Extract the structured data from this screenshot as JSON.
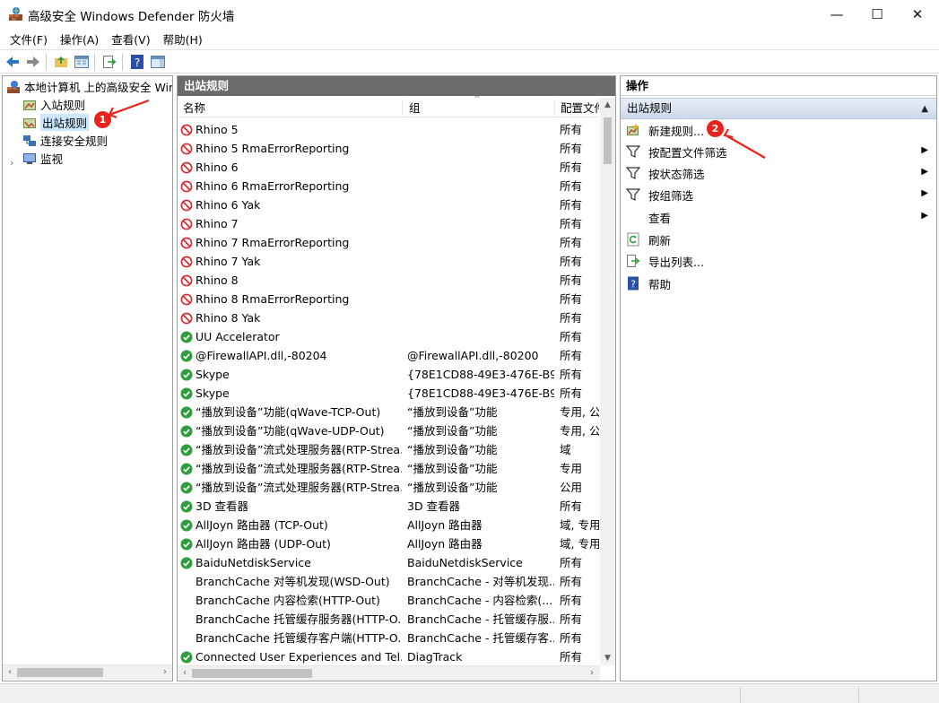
{
  "window": {
    "title": "高级安全 Windows Defender 防火墙",
    "controls": {
      "minimize": "—",
      "maximize": "☐",
      "close": "✕"
    }
  },
  "menu": [
    "文件(F)",
    "操作(A)",
    "查看(V)",
    "帮助(H)"
  ],
  "toolbar": {
    "icons": [
      "back-arrow-icon",
      "forward-arrow-icon",
      "up-folder-icon",
      "show-tree-icon",
      "export-icon",
      "help-icon",
      "action-pane-icon"
    ]
  },
  "tree": {
    "root": "本地计算机 上的高级安全 Windows Defender 防火墙",
    "items": [
      "入站规则",
      "出站规则",
      "连接安全规则",
      "监视"
    ],
    "selected": "出站规则"
  },
  "center": {
    "title": "出站规则",
    "columns": [
      "名称",
      "组",
      "配置文件"
    ],
    "rows": [
      {
        "name": "Rhino 5",
        "group": "",
        "profile": "所有",
        "status": "blocked"
      },
      {
        "name": "Rhino 5 RmaErrorReporting",
        "group": "",
        "profile": "所有",
        "status": "blocked"
      },
      {
        "name": "Rhino 6",
        "group": "",
        "profile": "所有",
        "status": "blocked"
      },
      {
        "name": "Rhino 6 RmaErrorReporting",
        "group": "",
        "profile": "所有",
        "status": "blocked"
      },
      {
        "name": "Rhino 6 Yak",
        "group": "",
        "profile": "所有",
        "status": "blocked"
      },
      {
        "name": "Rhino 7",
        "group": "",
        "profile": "所有",
        "status": "blocked"
      },
      {
        "name": "Rhino 7 RmaErrorReporting",
        "group": "",
        "profile": "所有",
        "status": "blocked"
      },
      {
        "name": "Rhino 7 Yak",
        "group": "",
        "profile": "所有",
        "status": "blocked"
      },
      {
        "name": "Rhino 8",
        "group": "",
        "profile": "所有",
        "status": "blocked"
      },
      {
        "name": "Rhino 8 RmaErrorReporting",
        "group": "",
        "profile": "所有",
        "status": "blocked"
      },
      {
        "name": "Rhino 8 Yak",
        "group": "",
        "profile": "所有",
        "status": "blocked"
      },
      {
        "name": "UU Accelerator",
        "group": "",
        "profile": "所有",
        "status": "allowed"
      },
      {
        "name": "@FirewallAPI.dll,-80204",
        "group": "@FirewallAPI.dll,-80200",
        "profile": "所有",
        "status": "allowed"
      },
      {
        "name": "Skype",
        "group": "{78E1CD88-49E3-476E-B9...",
        "profile": "所有",
        "status": "allowed"
      },
      {
        "name": "Skype",
        "group": "{78E1CD88-49E3-476E-B9...",
        "profile": "所有",
        "status": "allowed"
      },
      {
        "name": "“播放到设备”功能(qWave-TCP-Out)",
        "group": "“播放到设备”功能",
        "profile": "专用, 公",
        "status": "allowed"
      },
      {
        "name": "“播放到设备”功能(qWave-UDP-Out)",
        "group": "“播放到设备”功能",
        "profile": "专用, 公",
        "status": "allowed"
      },
      {
        "name": "“播放到设备”流式处理服务器(RTP-Strea...",
        "group": "“播放到设备”功能",
        "profile": "域",
        "status": "allowed"
      },
      {
        "name": "“播放到设备”流式处理服务器(RTP-Strea...",
        "group": "“播放到设备”功能",
        "profile": "专用",
        "status": "allowed"
      },
      {
        "name": "“播放到设备”流式处理服务器(RTP-Strea...",
        "group": "“播放到设备”功能",
        "profile": "公用",
        "status": "allowed"
      },
      {
        "name": "3D 查看器",
        "group": "3D 查看器",
        "profile": "所有",
        "status": "allowed"
      },
      {
        "name": "AllJoyn 路由器 (TCP-Out)",
        "group": "AllJoyn 路由器",
        "profile": "域, 专用",
        "status": "allowed"
      },
      {
        "name": "AllJoyn 路由器 (UDP-Out)",
        "group": "AllJoyn 路由器",
        "profile": "域, 专用",
        "status": "allowed"
      },
      {
        "name": "BaiduNetdiskService",
        "group": "BaiduNetdiskService",
        "profile": "所有",
        "status": "allowed"
      },
      {
        "name": "BranchCache 对等机发现(WSD-Out)",
        "group": "BranchCache - 对等机发现...",
        "profile": "所有",
        "status": "none"
      },
      {
        "name": "BranchCache 内容检索(HTTP-Out)",
        "group": "BranchCache - 内容检索(...",
        "profile": "所有",
        "status": "none"
      },
      {
        "name": "BranchCache 托管缓存服务器(HTTP-O...",
        "group": "BranchCache - 托管缓存服...",
        "profile": "所有",
        "status": "none"
      },
      {
        "name": "BranchCache 托管缓存客户端(HTTP-O...",
        "group": "BranchCache - 托管缓存客...",
        "profile": "所有",
        "status": "none"
      },
      {
        "name": "Connected User Experiences and Tel...",
        "group": "DiagTrack",
        "profile": "所有",
        "status": "allowed"
      }
    ]
  },
  "actions": {
    "title": "操作",
    "section": "出站规则",
    "items": [
      {
        "label": "新建规则...",
        "icon": "new-rule-icon",
        "submenu": false
      },
      {
        "label": "按配置文件筛选",
        "icon": "filter-icon",
        "submenu": true
      },
      {
        "label": "按状态筛选",
        "icon": "filter-icon",
        "submenu": true
      },
      {
        "label": "按组筛选",
        "icon": "filter-icon",
        "submenu": true
      },
      {
        "label": "查看",
        "icon": "",
        "submenu": true
      },
      {
        "label": "刷新",
        "icon": "refresh-icon",
        "submenu": false
      },
      {
        "label": "导出列表...",
        "icon": "export-list-icon",
        "submenu": false
      },
      {
        "label": "帮助",
        "icon": "help-icon",
        "submenu": false
      }
    ]
  },
  "annotations": {
    "badge1": "1",
    "badge2": "2"
  },
  "colors": {
    "annotation_red": "#e8231b",
    "blocked_red": "#d9262c",
    "allowed_green": "#2e9e3c",
    "selection_blue": "#cce8ff",
    "pane_header_gray": "#6b6b6b"
  }
}
